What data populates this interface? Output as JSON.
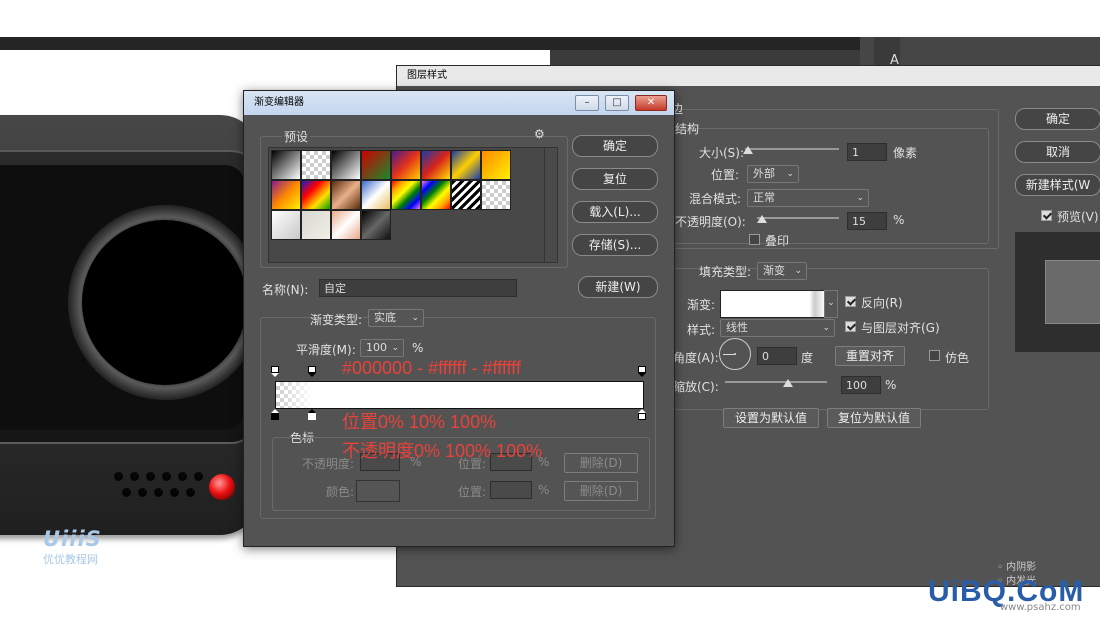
{
  "layer_style": {
    "title": "图层样式",
    "stroke_header": "边",
    "structure_header": "结构",
    "size_label": "大小(S):",
    "size_value": "1",
    "size_unit": "像素",
    "position_label": "位置:",
    "position_value": "外部",
    "blend_label": "混合模式:",
    "blend_value": "正常",
    "opacity_label": "不透明度(O):",
    "opacity_value": "15",
    "opacity_unit": "%",
    "overprint_label": "叠印",
    "fill_type_label": "填充类型:",
    "fill_type_value": "渐变",
    "gradient_label": "渐变:",
    "reverse_label": "反向(R)",
    "style_label": "样式:",
    "style_value": "线性",
    "align_label": "与图层对齐(G)",
    "angle_label": "角度(A):",
    "angle_value": "0",
    "angle_unit": "度",
    "reset_align_button": "重置对齐",
    "dither_label": "仿色",
    "scale_label": "缩放(C):",
    "scale_value": "100",
    "scale_unit": "%",
    "set_default_button": "设置为默认值",
    "reset_default_button": "复位为默认值",
    "ok_button": "确定",
    "cancel_button": "取消",
    "new_style_button": "新建样式(W",
    "preview_label": "预览(V)",
    "side_list": [
      "内阴影",
      "内发光"
    ]
  },
  "gradient_editor": {
    "title": "渐变编辑器",
    "presets_label": "预设",
    "ok_button": "确定",
    "reset_button": "复位",
    "load_button": "载入(L)...",
    "save_button": "存储(S)...",
    "name_label": "名称(N):",
    "name_value": "自定",
    "new_button": "新建(W)",
    "gradient_type_label": "渐变类型:",
    "gradient_type_value": "实底",
    "smoothness_label": "平滑度(M):",
    "smoothness_value": "100",
    "smoothness_unit": "%",
    "stops_label": "色标",
    "opacity_label": "不透明度:",
    "position_label": "位置:",
    "percent": "%",
    "delete_button": "删除(D)",
    "color_label": "颜色:",
    "preset_gradients": [
      "linear-gradient(135deg,#000,#fff)",
      "checker",
      "linear-gradient(135deg,#000,#fff 100%)",
      "linear-gradient(135deg,#c00,#1a8a2a)",
      "linear-gradient(135deg,#4a1a8a,#e3321a,#ffd000)",
      "linear-gradient(135deg,#1a3aa8,#d8231a,#ffe000)",
      "linear-gradient(135deg,#1a3aa8,#ffd000,#1a3aa8)",
      "linear-gradient(135deg,#ff8a00,#fff000)",
      "linear-gradient(135deg,#8a1a8a,#ff8a00,#fff000)",
      "linear-gradient(135deg,#1a1ac8,#ff0000,#ffe000,#00a000)",
      "linear-gradient(135deg,#5a2a0a,#e8b08a,#5a2a0a)",
      "linear-gradient(135deg,#3a6ac8,#fff,#e8c060)",
      "linear-gradient(135deg,red,orange,yellow,green,blue,violet)",
      "linear-gradient(135deg,violet,blue,green,yellow,orange,red)",
      "repeating-linear-gradient(135deg,#000 0 3px,#fff 3px 6px)",
      "checker",
      "linear-gradient(135deg,#fff,#c8c8c8)",
      "linear-gradient(135deg,#d8d8d0,#f0f0e8)",
      "linear-gradient(135deg,#e8a88a,#fff,#e8a88a)",
      "linear-gradient(135deg,#000,#666,#111)"
    ]
  },
  "annotations": {
    "colors": "#000000 - #ffffff - #ffffff",
    "positions": "位置0% 10% 100%",
    "opacities": "不透明度0% 100% 100%"
  },
  "watermarks": {
    "left_brand": "UiiiS",
    "left_text": "优优教程网",
    "site_logo": "UiBQ.CoM",
    "site_url": "www.psahz.com"
  },
  "right_panel": {
    "letter": "A"
  },
  "colors": {
    "dialog_bg": "#535353",
    "annotation": "#e8423a",
    "gradient_start": "#000000",
    "gradient_mid": "#ffffff",
    "gradient_end": "#ffffff"
  },
  "gradient": {
    "stop_positions_percent": [
      0,
      10,
      100
    ],
    "opacity_positions_percent": [
      0,
      10,
      100
    ],
    "opacity_values_percent": [
      0,
      100,
      100
    ]
  }
}
